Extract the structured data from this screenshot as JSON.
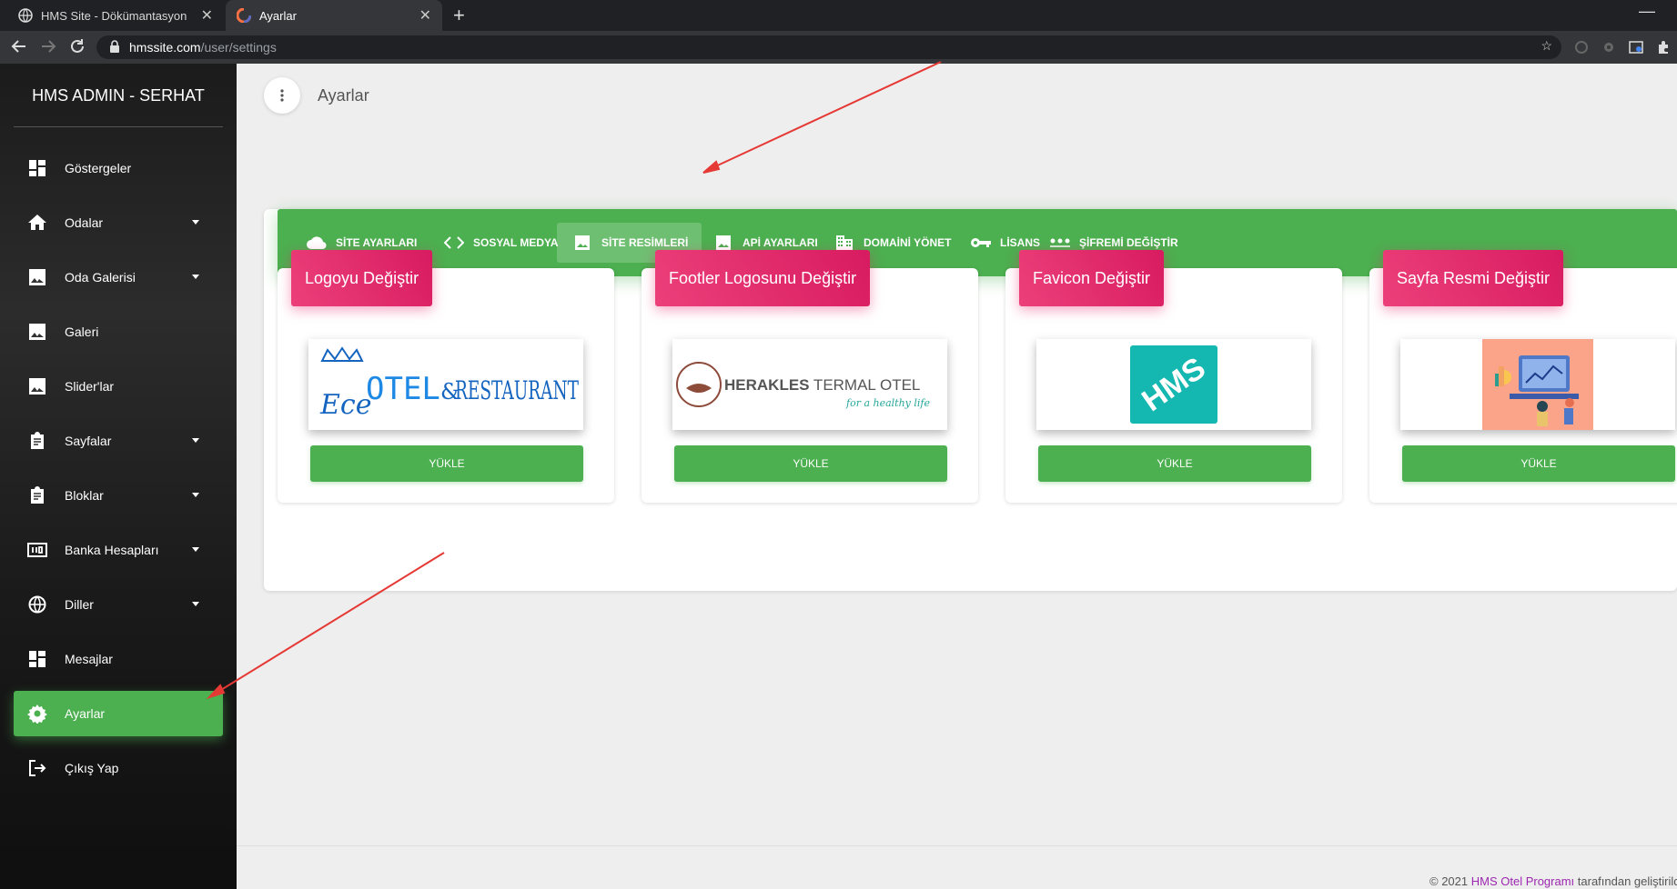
{
  "browser": {
    "tabs": [
      {
        "title": "HMS Site - Dökümantasyon",
        "active": false,
        "favicon": "globe-icon"
      },
      {
        "title": "Ayarlar",
        "active": true,
        "favicon": "app-logo-icon"
      }
    ],
    "new_tab_label": "+",
    "tab_close_glyph": "✕",
    "url_host": "hmssite.com",
    "url_path": "/user/settings"
  },
  "sidebar": {
    "brand": "HMS ADMIN - SERHAT",
    "items": [
      {
        "label": "Göstergeler",
        "icon": "dashboard-icon",
        "has_caret": false,
        "active": false
      },
      {
        "label": "Odalar",
        "icon": "home-icon",
        "has_caret": true,
        "active": false
      },
      {
        "label": "Oda Galerisi",
        "icon": "image-icon",
        "has_caret": true,
        "active": false
      },
      {
        "label": "Galeri",
        "icon": "image-icon",
        "has_caret": false,
        "active": false
      },
      {
        "label": "Slider'lar",
        "icon": "image-icon",
        "has_caret": false,
        "active": false
      },
      {
        "label": "Sayfalar",
        "icon": "clipboard-icon",
        "has_caret": true,
        "active": false
      },
      {
        "label": "Bloklar",
        "icon": "clipboard-icon",
        "has_caret": true,
        "active": false
      },
      {
        "label": "Banka Hesapları",
        "icon": "bank-counter-icon",
        "has_caret": true,
        "active": false
      },
      {
        "label": "Diller",
        "icon": "globe-icon",
        "has_caret": true,
        "active": false
      },
      {
        "label": "Mesajlar",
        "icon": "dashboard-icon",
        "has_caret": false,
        "active": false
      },
      {
        "label": "Ayarlar",
        "icon": "gear-icon",
        "has_caret": false,
        "active": true
      },
      {
        "label": "Çıkış Yap",
        "icon": "logout-icon",
        "has_caret": false,
        "active": false
      }
    ]
  },
  "page": {
    "title": "Ayarlar"
  },
  "settings_tabs": [
    {
      "label": "SİTE AYARLARI",
      "icon": "cloud-icon",
      "active": false
    },
    {
      "label": "SOSYAL MEDYA",
      "icon": "code-icon",
      "active": false
    },
    {
      "label": "SİTE RESİMLERİ",
      "icon": "image-icon",
      "active": true
    },
    {
      "label": "APİ AYARLARI",
      "icon": "image-icon",
      "active": false
    },
    {
      "label": "DOMAİNİ YÖNET",
      "icon": "building-icon",
      "active": false
    },
    {
      "label": "LİSANS",
      "icon": "key-icon",
      "active": false
    },
    {
      "label": "ŞİFREMİ DEĞİŞTİR",
      "icon": "password-dots-icon",
      "active": false
    }
  ],
  "image_cards": [
    {
      "title": "Logoyu Değiştir",
      "button": "YÜKLE",
      "preview": "otel-restaurant-logo",
      "logo_script": "Ece",
      "logo_word1": "OTEL",
      "logo_amp": "&",
      "logo_word2": "RESTAURANT"
    },
    {
      "title": "Footler Logosunu Değiştir",
      "button": "YÜKLE",
      "preview": "herakles-logo",
      "logo_main": "HERAKLES",
      "logo_rest": " TERMAL OTEL",
      "logo_tagline": "for a healthy life"
    },
    {
      "title": "Favicon Değiştir",
      "button": "YÜKLE",
      "preview": "hms-favicon",
      "logo_text": "HMS"
    },
    {
      "title": "Sayfa Resmi Değiştir",
      "button": "YÜKLE",
      "preview": "analytics-illustration"
    }
  ],
  "footer": {
    "prefix": "© 2021 ",
    "link": "HMS Otel Programı",
    "suffix": " tarafından geliştirildi"
  },
  "colors": {
    "accent_green": "#4caf50",
    "accent_pink": "#e91e63",
    "annotation_arrow": "#e53935"
  }
}
